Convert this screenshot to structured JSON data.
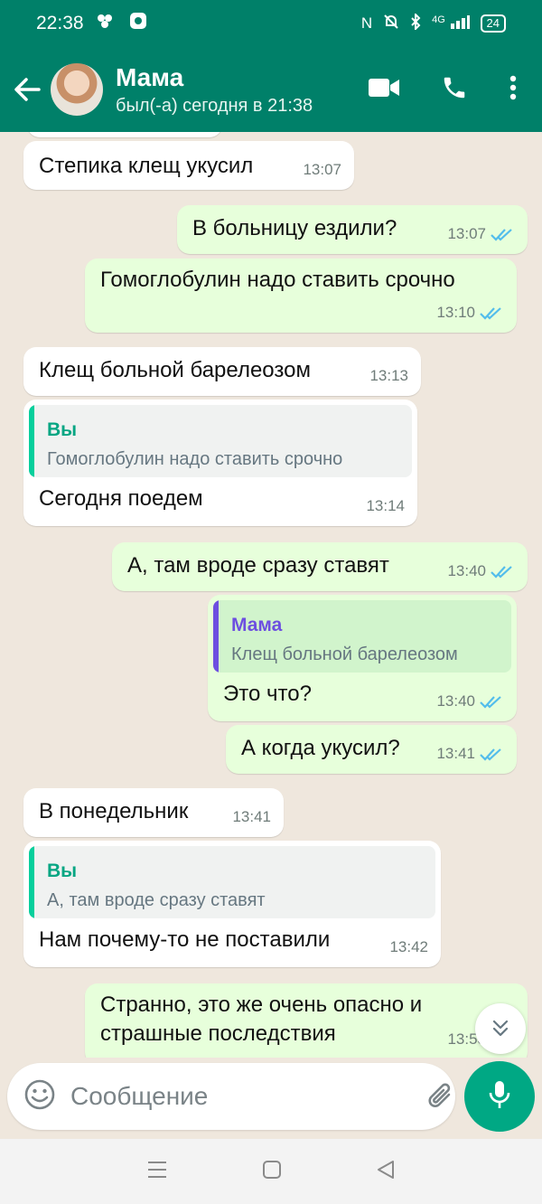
{
  "status_bar": {
    "time": "22:38",
    "network": "4G",
    "battery": "24"
  },
  "header": {
    "name": "Мама",
    "status": "был(-а) сегодня в 21:38"
  },
  "messages": [
    {
      "text": "Степика клещ укусил",
      "time": "13:07"
    },
    {
      "text": "В больницу ездили?",
      "time": "13:07"
    },
    {
      "text": "Гомоглобулин надо ставить срочно",
      "time": "13:10"
    },
    {
      "text": "Клещ больной барелеозом",
      "time": "13:13"
    },
    {
      "quote_name": "Вы",
      "quote_text": "Гомоглобулин надо ставить срочно",
      "text": "Сегодня поедем",
      "time": "13:14"
    },
    {
      "text": "А, там вроде сразу ставят",
      "time": "13:40"
    },
    {
      "quote_name": "Мама",
      "quote_text": "Клещ больной барелеозом",
      "text": "Это что?",
      "time": "13:40"
    },
    {
      "text": "А когда укусил?",
      "time": "13:41"
    },
    {
      "text": "В понедельник",
      "time": "13:41"
    },
    {
      "quote_name": "Вы",
      "quote_text": "А, там вроде сразу ставят",
      "text": "Нам почему-то не поставили",
      "time": "13:42"
    },
    {
      "line1": "Странно, это же очень опасно и",
      "line2": "страшные последствия",
      "time": "13:53"
    }
  ],
  "composer": {
    "placeholder": "Сообщение"
  },
  "colors": {
    "header": "#008069",
    "incoming": "#ffffff",
    "outgoing": "#e7ffdb",
    "ticks_read": "#53bdeb",
    "quote_you": "#06cf9c",
    "quote_contact": "#6d4fe0",
    "mic": "#00a884"
  },
  "icons": [
    "back-arrow-icon",
    "video-call-icon",
    "phone-icon",
    "more-icon",
    "emoji-icon",
    "attach-icon",
    "camera-icon",
    "mic-icon",
    "scroll-down-icon"
  ]
}
